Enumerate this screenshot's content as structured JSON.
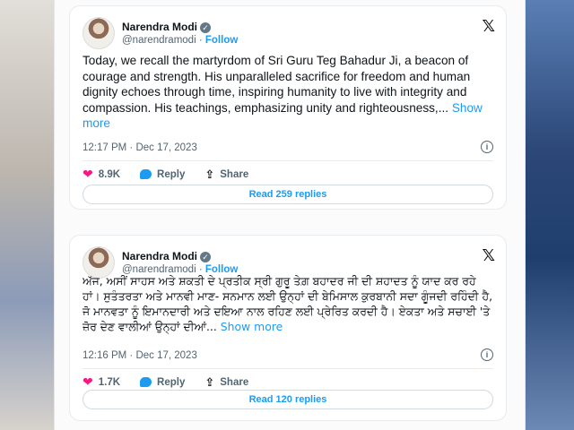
{
  "tweets": [
    {
      "author": "Narendra Modi",
      "handle": "@narendramodi",
      "follow_label": "Follow",
      "text": "Today, we recall the martyrdom of Sri Guru Teg Bahadur Ji, a beacon of courage and strength. His unparalleled sacrifice for freedom and human dignity echoes through time, inspiring humanity to live with integrity and compassion. His teachings, emphasizing unity and righteousness,...",
      "show_more": "Show more",
      "timestamp": "12:17 PM · Dec 17, 2023",
      "likes": "8.9K",
      "reply_label": "Reply",
      "share_label": "Share",
      "read_replies": "Read 259 replies"
    },
    {
      "author": "Narendra Modi",
      "handle": "@narendramodi",
      "follow_label": "Follow",
      "text": "ਅੱਜ, ਅਸੀਂ ਸਾਹਸ ਅਤੇ ਸ਼ਕਤੀ ਦੇ ਪ੍ਰਤੀਕ ਸ੍ਰੀ ਗੁਰੂ ਤੇਗ਼ ਬਹਾਦਰ ਜੀ ਦੀ ਸ਼ਹਾਦਤ ਨੂੰ ਯਾਦ ਕਰ ਰਹੇ ਹਾਂ। ਸੁਤੰਤਰਤਾ ਅਤੇ ਮਾਨਵੀ ਮਾਣ- ਸਨਮਾਨ ਲਈ ਉਨ੍ਹਾਂ ਦੀ ਬੇਮਿਸਾਲ ਕੁਰਬਾਨੀ ਸਦਾ ਗੂੰਜਦੀ ਰਹਿੰਦੀ ਹੈ, ਜੋ ਮਾਨਵਤਾ ਨੂੰ ਇਮਾਨਦਾਰੀ ਅਤੇ ਦਇਆ ਨਾਲ ਰਹਿਣ ਲਈ ਪ੍ਰੇਰਿਤ ਕਰਦੀ ਹੈ।  ਏਕਤਾ ਅਤੇ ਸਚਾਈ 'ਤੇ ਜ਼ੋਰ ਦੇਣ ਵਾਲੀਆਂ ਉਨ੍ਹਾਂ ਦੀਆਂ...",
      "show_more": "Show more",
      "timestamp": "12:16 PM · Dec 17, 2023",
      "likes": "1.7K",
      "reply_label": "Reply",
      "share_label": "Share",
      "read_replies": "Read 120 replies"
    }
  ]
}
